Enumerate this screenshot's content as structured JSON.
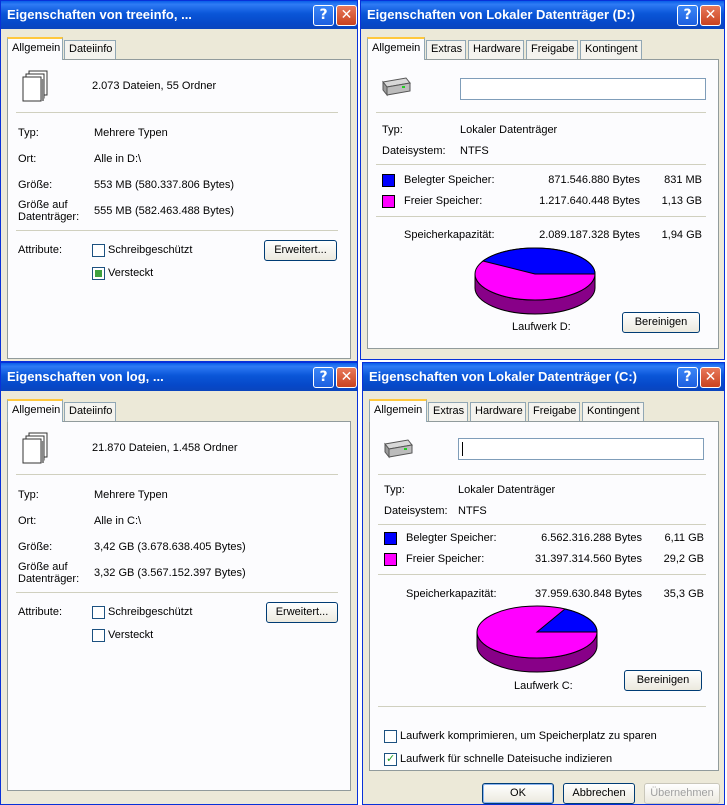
{
  "colors": {
    "used": "#0000ff",
    "free": "#ff00ff"
  },
  "icons": {
    "files": "multiple-files-icon",
    "drive": "hard-drive-icon",
    "help": "help-icon",
    "close": "close-icon"
  },
  "win_tl": {
    "title": "Eigenschaften von treeinfo, ...",
    "tabs": [
      "Allgemein",
      "Dateiinfo"
    ],
    "summary": "2.073 Dateien, 55 Ordner",
    "type_label": "Typ:",
    "type_value": "Mehrere Typen",
    "location_label": "Ort:",
    "location_value": "Alle in D:\\",
    "size_label": "Größe:",
    "size_value": "553 MB (580.337.806 Bytes)",
    "disk_size_label_1": "Größe auf",
    "disk_size_label_2": "Datenträger:",
    "disk_size_value": "555 MB (582.463.488 Bytes)",
    "attributes_label": "Attribute:",
    "readonly_label": "Schreibgeschützt",
    "hidden_label": "Versteckt",
    "advanced_button": "Erweitert...",
    "readonly_checked": false,
    "hidden_state": "indeterminate"
  },
  "win_tr": {
    "title": "Eigenschaften von Lokaler Datenträger (D:)",
    "tabs": [
      "Allgemein",
      "Extras",
      "Hardware",
      "Freigabe",
      "Kontingent"
    ],
    "label_value": "",
    "type_label": "Typ:",
    "type_value": "Lokaler Datenträger",
    "fs_label": "Dateisystem:",
    "fs_value": "NTFS",
    "used_label": "Belegter Speicher:",
    "used_bytes": "871.546.880 Bytes",
    "used_human": "831 MB",
    "free_label": "Freier Speicher:",
    "free_bytes": "1.217.640.448 Bytes",
    "free_human": "1,13 GB",
    "capacity_label": "Speicherkapazität:",
    "capacity_bytes": "2.089.187.328 Bytes",
    "capacity_human": "1,94 GB",
    "drive_label": "Laufwerk D:",
    "cleanup_button": "Bereinigen",
    "used_fraction": 0.417
  },
  "win_bl": {
    "title": "Eigenschaften von log, ...",
    "tabs": [
      "Allgemein",
      "Dateiinfo"
    ],
    "summary": "21.870 Dateien, 1.458 Ordner",
    "type_label": "Typ:",
    "type_value": "Mehrere Typen",
    "location_label": "Ort:",
    "location_value": "Alle in C:\\",
    "size_label": "Größe:",
    "size_value": "3,42 GB (3.678.638.405 Bytes)",
    "disk_size_label_1": "Größe auf",
    "disk_size_label_2": "Datenträger:",
    "disk_size_value": "3,32 GB (3.567.152.397 Bytes)",
    "attributes_label": "Attribute:",
    "readonly_label": "Schreibgeschützt",
    "hidden_label": "Versteckt",
    "advanced_button": "Erweitert...",
    "readonly_checked": false,
    "hidden_checked": false
  },
  "win_br": {
    "title": "Eigenschaften von Lokaler Datenträger (C:)",
    "tabs": [
      "Allgemein",
      "Extras",
      "Hardware",
      "Freigabe",
      "Kontingent"
    ],
    "label_value": "",
    "type_label": "Typ:",
    "type_value": "Lokaler Datenträger",
    "fs_label": "Dateisystem:",
    "fs_value": "NTFS",
    "used_label": "Belegter Speicher:",
    "used_bytes": "6.562.316.288 Bytes",
    "used_human": "6,11 GB",
    "free_label": "Freier Speicher:",
    "free_bytes": "31.397.314.560 Bytes",
    "free_human": "29,2 GB",
    "capacity_label": "Speicherkapazität:",
    "capacity_bytes": "37.959.630.848 Bytes",
    "capacity_human": "35,3 GB",
    "drive_label": "Laufwerk C:",
    "cleanup_button": "Bereinigen",
    "used_fraction": 0.173,
    "compress_label": "Laufwerk komprimieren, um Speicherplatz zu sparen",
    "index_label": "Laufwerk für schnelle Dateisuche indizieren",
    "compress_checked": false,
    "index_checked": true,
    "ok_button": "OK",
    "cancel_button": "Abbrechen",
    "apply_button": "Übernehmen"
  }
}
